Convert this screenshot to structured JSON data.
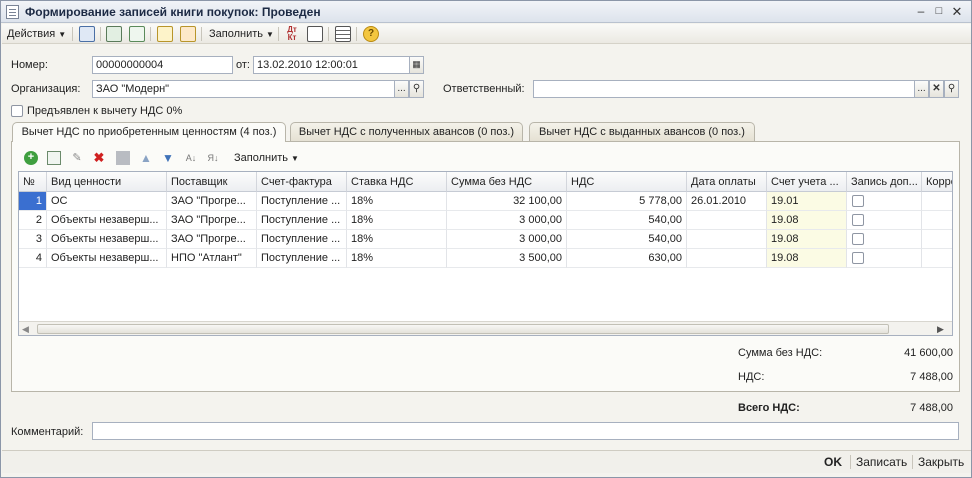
{
  "window": {
    "title": "Формирование записей книги покупок: Проведен"
  },
  "toolbar": {
    "actions_label": "Действия",
    "fill_label": "Заполнить"
  },
  "form": {
    "number_label": "Номер:",
    "number_value": "00000000004",
    "date_label": "от:",
    "date_value": "13.02.2010 12:00:01",
    "org_label": "Организация:",
    "org_value": "ЗАО \"Модерн\"",
    "resp_label": "Ответственный:",
    "resp_value": "",
    "vat0_label": "Предъявлен к вычету НДС 0%"
  },
  "tabs": [
    {
      "label": "Вычет НДС по приобретенным ценностям (4 поз.)"
    },
    {
      "label": "Вычет НДС с полученных авансов (0 поз.)"
    },
    {
      "label": "Вычет НДС с выданных авансов (0 поз.)"
    }
  ],
  "panel_toolbar": {
    "fill_label": "Заполнить"
  },
  "table": {
    "headers": [
      "№",
      "Вид ценности",
      "Поставщик",
      "Счет-фактура",
      "Ставка НДС",
      "Сумма без НДС",
      "НДС",
      "Дата оплаты",
      "Счет учета ...",
      "Запись доп...",
      "Корре"
    ],
    "rows": [
      {
        "n": "1",
        "kind": "ОС",
        "supplier": "ЗАО \"Прогре...",
        "invoice": "Поступление ...",
        "rate": "18%",
        "sum": "32 100,00",
        "vat": "5 778,00",
        "paydate": "26.01.2010",
        "account": "19.01"
      },
      {
        "n": "2",
        "kind": "Объекты незаверш...",
        "supplier": "ЗАО \"Прогре...",
        "invoice": "Поступление ...",
        "rate": "18%",
        "sum": "3 000,00",
        "vat": "540,00",
        "paydate": "",
        "account": "19.08"
      },
      {
        "n": "3",
        "kind": "Объекты незаверш...",
        "supplier": "ЗАО \"Прогре...",
        "invoice": "Поступление ...",
        "rate": "18%",
        "sum": "3 000,00",
        "vat": "540,00",
        "paydate": "",
        "account": "19.08"
      },
      {
        "n": "4",
        "kind": "Объекты незаверш...",
        "supplier": "НПО \"Атлант\"",
        "invoice": "Поступление ...",
        "rate": "18%",
        "sum": "3 500,00",
        "vat": "630,00",
        "paydate": "",
        "account": "19.08"
      }
    ]
  },
  "totals": {
    "sum_label": "Сумма без НДС:",
    "sum_value": "41 600,00",
    "vat_label": "НДС:",
    "vat_value": "7 488,00",
    "total_vat_label": "Всего НДС:",
    "total_vat_value": "7 488,00"
  },
  "comment": {
    "label": "Комментарий:",
    "value": ""
  },
  "buttons": {
    "ok": "OK",
    "save": "Записать",
    "close": "Закрыть"
  }
}
